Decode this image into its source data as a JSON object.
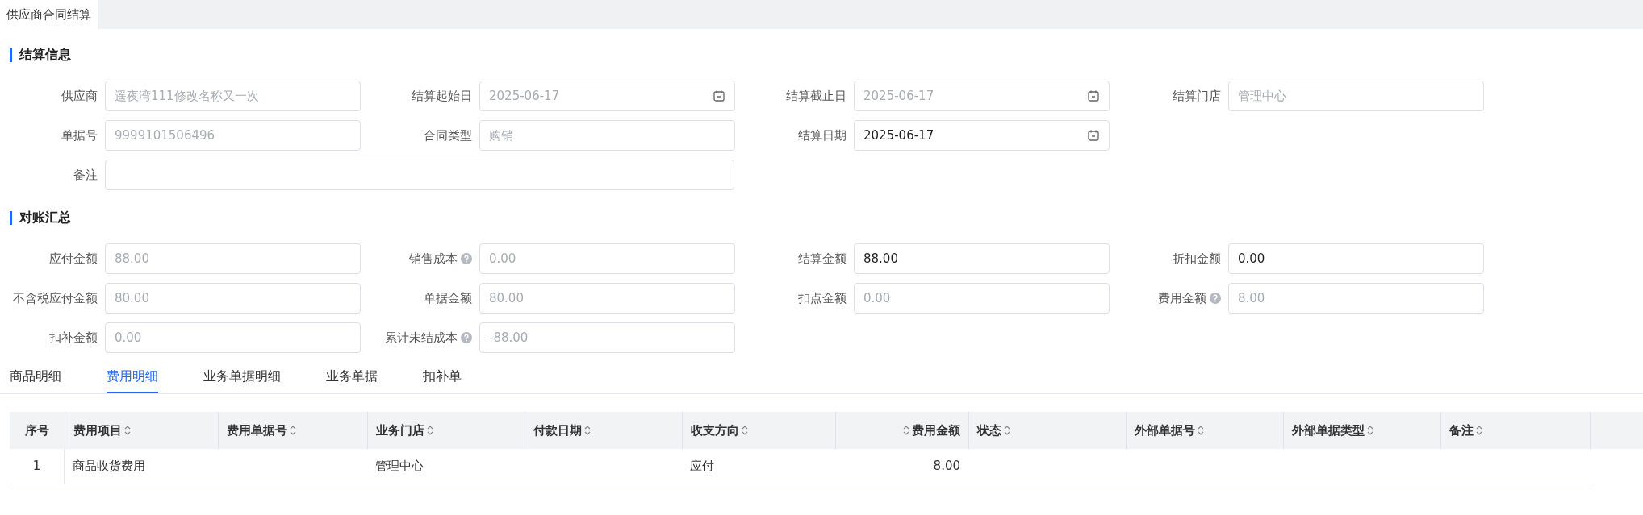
{
  "page_tabs": [
    {
      "label": "供应商合同结算",
      "selected": true
    }
  ],
  "sections": [
    {
      "title": "结算信息",
      "fields": [
        {
          "label": "供应商",
          "value": "遥夜湾111修改名称又一次",
          "kind": "text",
          "disabled": true
        },
        {
          "label": "结算起始日",
          "value": "2025-06-17",
          "kind": "date",
          "disabled": true
        },
        {
          "label": "结算截止日",
          "value": "2025-06-17",
          "kind": "date",
          "disabled": true
        },
        {
          "label": "结算门店",
          "value": "管理中心",
          "kind": "text",
          "disabled": true
        },
        {
          "label": "单据号",
          "value": "9999101506496",
          "kind": "text",
          "disabled": true
        },
        {
          "label": "合同类型",
          "value": "购销",
          "kind": "text",
          "disabled": true
        },
        {
          "label": "结算日期",
          "value": "2025-06-17",
          "kind": "date",
          "disabled": false
        },
        {
          "kind": "blank"
        },
        {
          "label": "备注",
          "kind": "wide"
        }
      ]
    },
    {
      "title": "对账汇总",
      "fields": [
        {
          "label": "应付金额",
          "value": "88.00",
          "kind": "text",
          "disabled": true
        },
        {
          "label": "销售成本",
          "value": "0.00",
          "kind": "text",
          "disabled": true,
          "help": true
        },
        {
          "label": "结算金额",
          "value": "88.00",
          "kind": "text",
          "disabled": false
        },
        {
          "label": "折扣金额",
          "value": "0.00",
          "kind": "text",
          "disabled": false
        },
        {
          "label": "不含税应付金额",
          "value": "80.00",
          "kind": "text",
          "disabled": true
        },
        {
          "label": "单据金额",
          "value": "80.00",
          "kind": "text",
          "disabled": true
        },
        {
          "label": "扣点金额",
          "value": "0.00",
          "kind": "text",
          "disabled": true
        },
        {
          "label": "费用金额",
          "value": "8.00",
          "kind": "text",
          "disabled": true,
          "help": true
        },
        {
          "label": "扣补金额",
          "value": "0.00",
          "kind": "text",
          "disabled": true
        },
        {
          "label": "累计未结成本",
          "value": "-88.00",
          "kind": "text",
          "disabled": true,
          "help": true
        }
      ]
    }
  ],
  "detail_tabs": [
    {
      "label": "商品明细",
      "selected": false
    },
    {
      "label": "费用明细",
      "selected": true
    },
    {
      "label": "业务单据明细",
      "selected": false
    },
    {
      "label": "业务单据",
      "selected": false
    },
    {
      "label": "扣补单",
      "selected": false
    }
  ],
  "table": {
    "columns": [
      {
        "label": "序号",
        "kind": "index"
      },
      {
        "label": "费用项目",
        "kind": "text",
        "sortable": true
      },
      {
        "label": "费用单据号",
        "kind": "text",
        "sortable": true
      },
      {
        "label": "业务门店",
        "kind": "text",
        "sortable": true
      },
      {
        "label": "付款日期",
        "kind": "text",
        "sortable": true
      },
      {
        "label": "收支方向",
        "kind": "text",
        "sortable": true
      },
      {
        "label": "费用金额",
        "kind": "number",
        "sortable": true
      },
      {
        "label": "状态",
        "kind": "text",
        "sortable": true
      },
      {
        "label": "外部单据号",
        "kind": "text",
        "sortable": true
      },
      {
        "label": "外部单据类型",
        "kind": "text",
        "sortable": true
      },
      {
        "label": "备注",
        "kind": "text",
        "sortable": true
      }
    ],
    "rows": [
      [
        "1",
        "商品收货费用",
        "",
        "管理中心",
        "",
        "应付",
        "8.00",
        "",
        "",
        "",
        ""
      ]
    ]
  }
}
